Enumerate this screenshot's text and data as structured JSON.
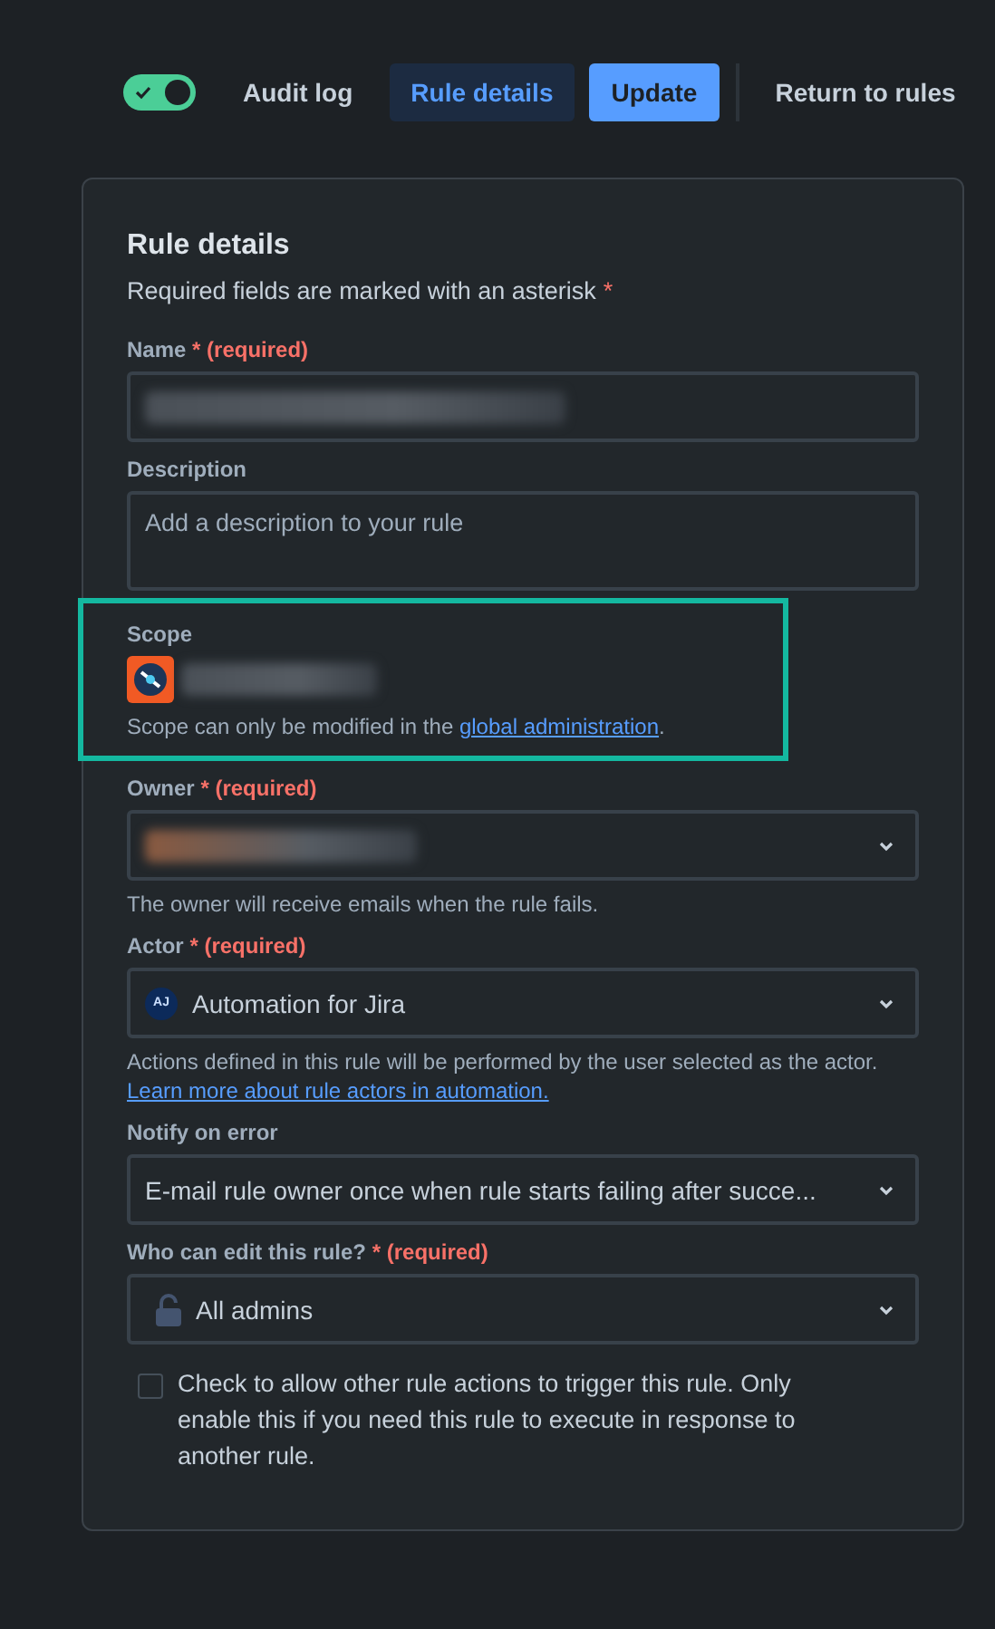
{
  "toolbar": {
    "audit_toggle": {
      "on": true
    },
    "audit_label": "Audit log",
    "rule_details": {
      "label": "Rule details",
      "selected": true
    },
    "update": "Update",
    "return": "Return to rules"
  },
  "card": {
    "title": "Rule details",
    "subtitle": "Required fields are marked with an asterisk",
    "subtitle_mark": "*",
    "fields": [
      {
        "kind": "text",
        "label": "Name",
        "required": true,
        "required_mark": "*",
        "required_text": "(required)",
        "redacted": true
      },
      {
        "kind": "textarea",
        "label": "Description",
        "placeholder": "Add a description to your rule"
      },
      {
        "kind": "scope",
        "label": "Scope",
        "highlighted": true,
        "redacted": true,
        "help": "Scope can only be modified in the ",
        "link": "global administration",
        "help_end": "."
      },
      {
        "kind": "select",
        "label": "Owner",
        "required": true,
        "required_mark": "*",
        "required_text": "(required)",
        "redacted": true,
        "help": "The owner will receive emails when the rule fails."
      },
      {
        "kind": "actor-select",
        "label": "Actor",
        "required": true,
        "required_mark": "*",
        "required_text": "(required)",
        "avatar": "AJ",
        "value": "Automation for Jira",
        "help": "Actions defined in this rule will be performed by the user selected as the actor. ",
        "link": "Learn more about rule actors in automation."
      },
      {
        "kind": "select",
        "label": "Notify on error",
        "value": "E-mail rule owner once when rule starts failing after succe..."
      },
      {
        "kind": "permission-select",
        "label": "Who can edit this rule?",
        "required": true,
        "required_mark": "*",
        "required_text": "(required)",
        "value": "All admins"
      }
    ],
    "checkbox": {
      "checked": false,
      "label": "Check to allow other rule actions to trigger this rule. Only enable this if you need this rule to execute in response to another rule."
    }
  }
}
